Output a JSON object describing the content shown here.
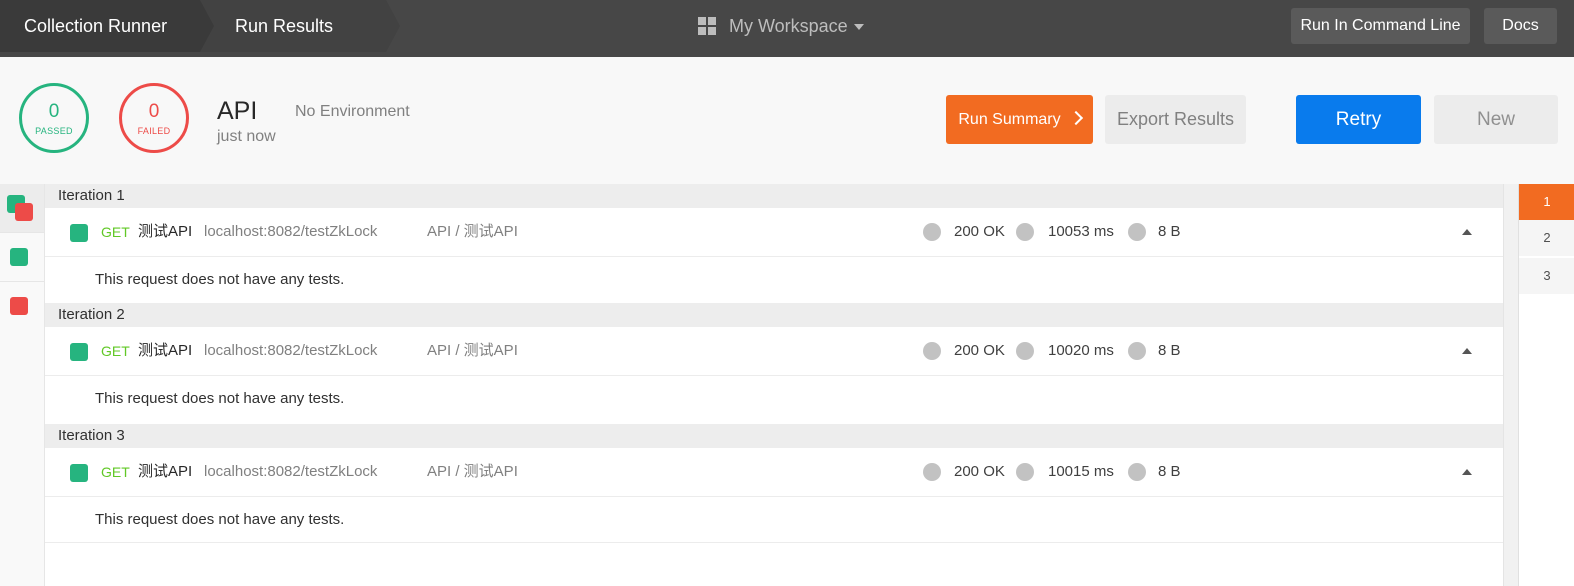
{
  "topbar": {
    "breadcrumbs": [
      "Collection Runner",
      "Run Results"
    ],
    "workspace": "My Workspace",
    "cmd_button": "Run In Command Line",
    "docs_button": "Docs"
  },
  "summary": {
    "passed_count": "0",
    "passed_label": "PASSED",
    "failed_count": "0",
    "failed_label": "FAILED",
    "run_name": "API",
    "run_time": "just now",
    "environment": "No Environment"
  },
  "actions": {
    "run_summary": "Run Summary",
    "export": "Export Results",
    "retry": "Retry",
    "new": "New"
  },
  "iterations": [
    {
      "label": "Iteration 1",
      "request": {
        "method": "GET",
        "name": "测试API",
        "url": "localhost:8082/testZkLock",
        "path": "API / 测试API",
        "status": "200 OK",
        "time": "10053 ms",
        "size": "8 B"
      },
      "tests_message": "This request does not have any tests."
    },
    {
      "label": "Iteration 2",
      "request": {
        "method": "GET",
        "name": "测试API",
        "url": "localhost:8082/testZkLock",
        "path": "API / 测试API",
        "status": "200 OK",
        "time": "10020 ms",
        "size": "8 B"
      },
      "tests_message": "This request does not have any tests."
    },
    {
      "label": "Iteration 3",
      "request": {
        "method": "GET",
        "name": "测试API",
        "url": "localhost:8082/testZkLock",
        "path": "API / 测试API",
        "status": "200 OK",
        "time": "10015 ms",
        "size": "8 B"
      },
      "tests_message": "This request does not have any tests."
    }
  ],
  "pager": {
    "pages": [
      "1",
      "2",
      "3"
    ],
    "active": "1"
  },
  "colors": {
    "accent_orange": "#f26b21",
    "primary_blue": "#097bed",
    "pass_green": "#26b47f",
    "fail_red": "#ed4b48",
    "method_get": "#61c826"
  }
}
